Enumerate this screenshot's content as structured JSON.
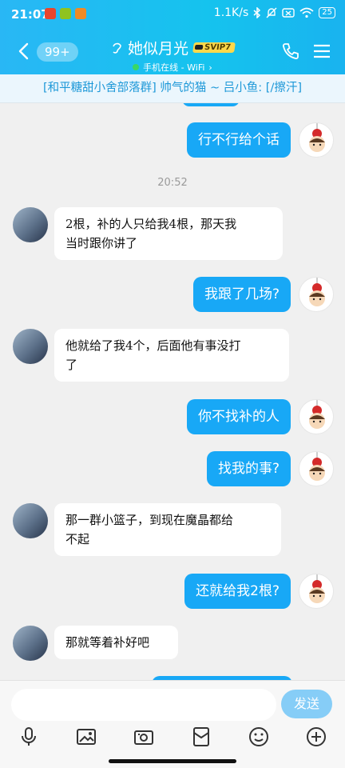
{
  "status": {
    "time": "21:07",
    "speed": "1.1K/s",
    "battery": "25",
    "app_colors": [
      "#e8452c",
      "#8fc31f",
      "#f08a24"
    ]
  },
  "header": {
    "unread_badge": "99+",
    "contact_name": "她似月光",
    "vip_badge": "SVIP7",
    "online_status": "手机在线 - WiFi",
    "icons": [
      "back-icon",
      "ear-icon",
      "phone-icon",
      "menu-icon"
    ]
  },
  "notice": {
    "text": "[和平糖甜小舍部落群] 帅气的猫 ~ 吕小鱼: [/擦汗]"
  },
  "messages": [
    {
      "side": "out",
      "text": "行不行给个话"
    },
    {
      "side": "time",
      "text": "20:52"
    },
    {
      "side": "in",
      "lines": [
        "2根，补的人只给我4根，那天我",
        "当时跟你讲了"
      ]
    },
    {
      "side": "out",
      "text": "我跟了几场?"
    },
    {
      "side": "in",
      "lines": [
        "他就给了我4个，后面他有事没打",
        "了"
      ]
    },
    {
      "side": "out",
      "text": "你不找补的人"
    },
    {
      "side": "out",
      "text": "找我的事?"
    },
    {
      "side": "in",
      "lines": [
        "那一群小篮子，到现在魔晶都给",
        "不起"
      ]
    },
    {
      "side": "out",
      "text": "还就给我2根?"
    },
    {
      "side": "in",
      "lines": [
        "那就等着补好吧"
      ]
    }
  ],
  "input": {
    "placeholder": "",
    "send_label": "发送",
    "tools": [
      "microphone-icon",
      "image-icon",
      "camera-icon",
      "red-packet-icon",
      "emoji-icon",
      "plus-icon"
    ]
  },
  "colors": {
    "header": "#22b8f2",
    "bubble_out": "#18a8f6",
    "bubble_in": "#ffffff",
    "notice_text": "#1d98d8",
    "send_button": "#86cdf7"
  }
}
